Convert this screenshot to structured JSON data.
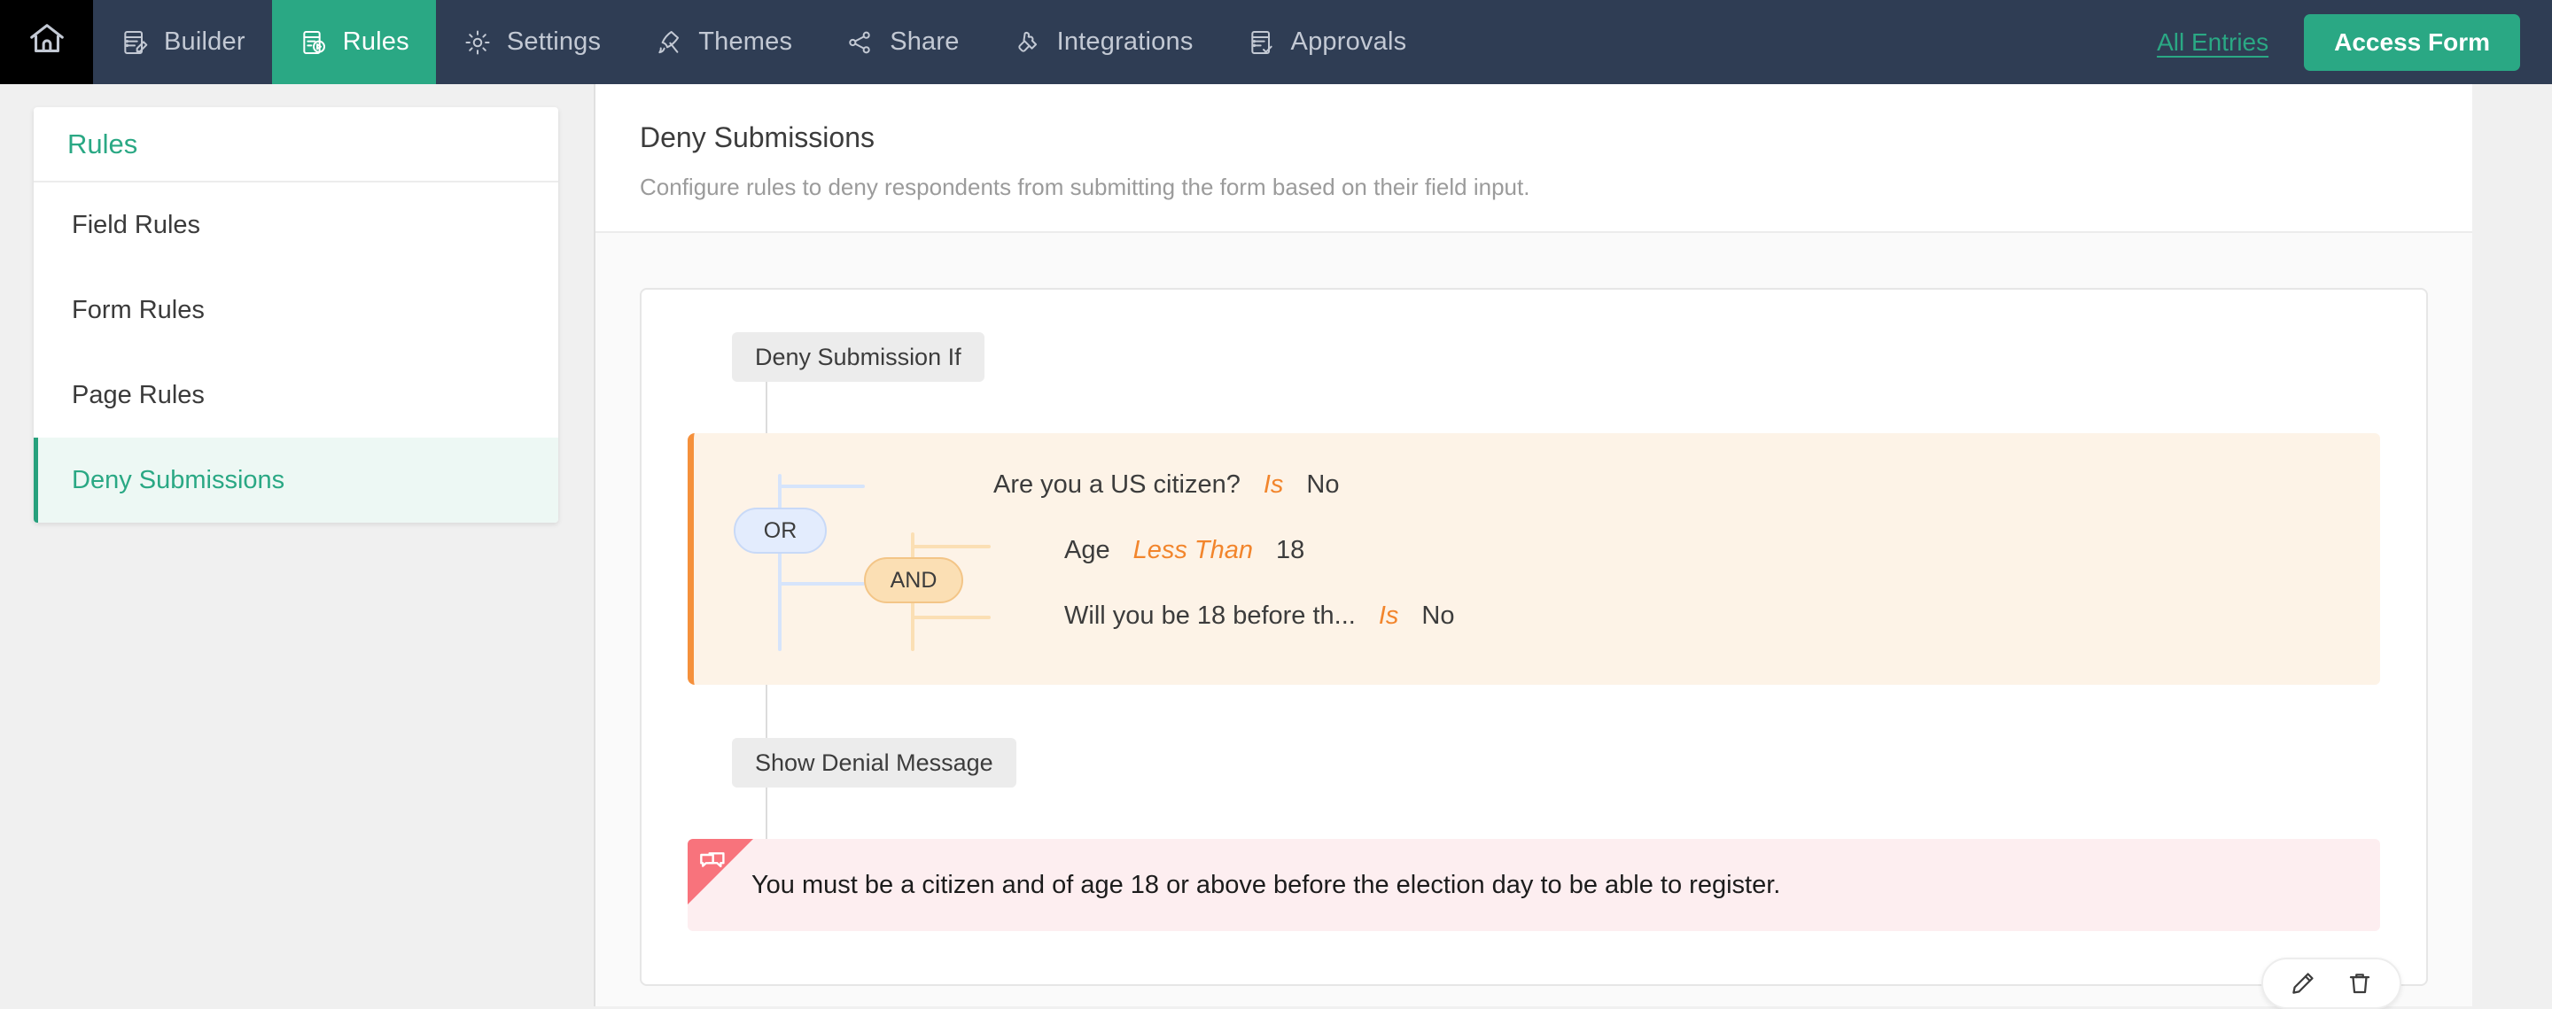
{
  "topnav": {
    "home_icon": "home-icon",
    "items": [
      {
        "label": "Builder",
        "icon": "builder-icon",
        "active": false
      },
      {
        "label": "Rules",
        "icon": "rules-icon",
        "active": true
      },
      {
        "label": "Settings",
        "icon": "gear-icon",
        "active": false
      },
      {
        "label": "Themes",
        "icon": "brush-icon",
        "active": false
      },
      {
        "label": "Share",
        "icon": "share-icon",
        "active": false
      },
      {
        "label": "Integrations",
        "icon": "puzzle-icon",
        "active": false
      },
      {
        "label": "Approvals",
        "icon": "approvals-icon",
        "active": false
      }
    ],
    "all_entries_label": "All Entries",
    "access_form_label": "Access Form",
    "accent_color": "#2aa884",
    "bar_color": "#2f3d54"
  },
  "sidebar": {
    "title": "Rules",
    "items": [
      {
        "label": "Field Rules",
        "active": false
      },
      {
        "label": "Form Rules",
        "active": false
      },
      {
        "label": "Page Rules",
        "active": false
      },
      {
        "label": "Deny Submissions",
        "active": true
      }
    ],
    "active_color": "#2aa884",
    "active_bg": "#edf8f4"
  },
  "panel": {
    "title": "Deny Submissions",
    "subtitle": "Configure rules to deny respondents from submitting the form based on their field input."
  },
  "rule": {
    "condition_step_label": "Deny Submission If",
    "action_step_label": "Show Denial Message",
    "logic": {
      "outer_operator": "OR",
      "inner_operator": "AND",
      "outer_color": "#d6e4fb",
      "inner_color": "#fbdfb4"
    },
    "conditions": [
      {
        "field": "Are you a US citizen?",
        "operator": "Is",
        "value": "No"
      },
      {
        "field": "Age",
        "operator": "Less Than",
        "value": "18"
      },
      {
        "field": "Will you be 18 before th...",
        "operator": "Is",
        "value": "No"
      }
    ],
    "denial_message": "You must be a citizen and of age 18 or above before the election day to be able to register.",
    "denial_icon": "chat-bubbles-icon",
    "denial_accent": "#f8737c",
    "condition_accent": "#f5903b",
    "operator_text_color": "#f2852c",
    "actions": [
      {
        "name": "edit-rule-button",
        "icon": "pencil-icon"
      },
      {
        "name": "delete-rule-button",
        "icon": "trash-icon"
      }
    ]
  }
}
